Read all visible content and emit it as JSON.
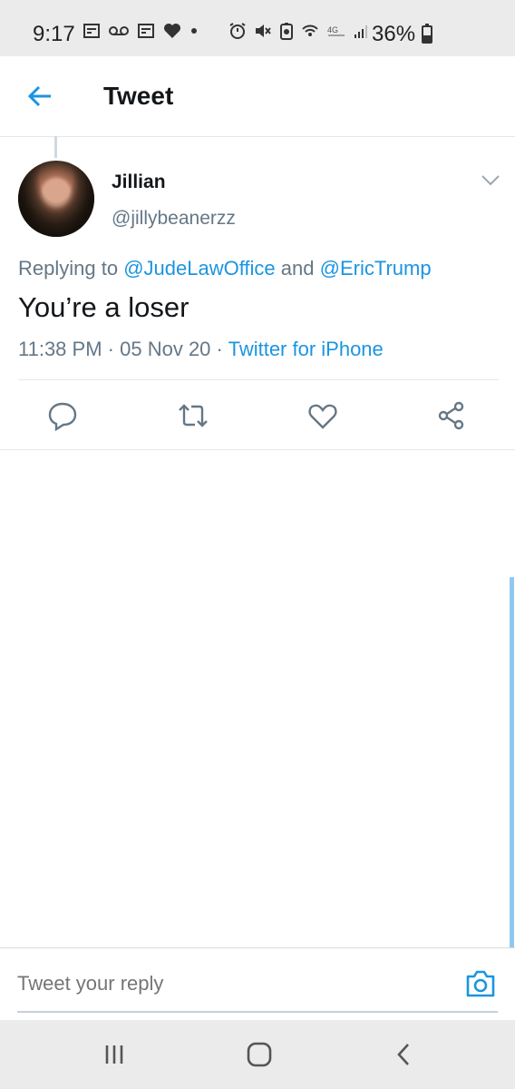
{
  "status_bar": {
    "time": "9:17",
    "battery_percent": "36%",
    "left_icons": [
      "news-icon",
      "voicemail-icon",
      "news-icon",
      "heart-icon",
      "dot-icon"
    ],
    "right_icons": [
      "alarm-icon",
      "mute-icon",
      "battery-saver-icon",
      "wifi-icon",
      "lte-icon",
      "signal-icon",
      "battery-icon"
    ]
  },
  "header": {
    "title": "Tweet",
    "back_icon": "arrow-left-icon"
  },
  "tweet": {
    "author_name": "Jillian",
    "author_handle": "@jillybeanerzz",
    "replying_prefix": "Replying to",
    "replying_to": [
      "@JudeLawOffice",
      "@EricTrump"
    ],
    "replying_conjunction": "and",
    "text": "You’re a loser",
    "time": "11:38 PM",
    "date": "05 Nov 20",
    "separator": "·",
    "source": "Twitter for iPhone"
  },
  "actions": [
    "reply-icon",
    "retweet-icon",
    "like-icon",
    "share-icon"
  ],
  "reply_composer": {
    "placeholder": "Tweet your reply"
  },
  "colors": {
    "accent": "#1b95e0",
    "secondary_text": "#657786",
    "primary_text": "#14171a"
  }
}
